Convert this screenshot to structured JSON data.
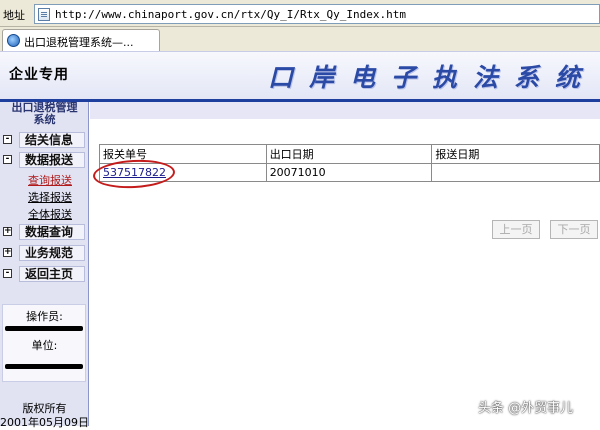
{
  "address_bar": {
    "label": "地址",
    "url": "http://www.chinaport.gov.cn/rtx/Qy_I/Rtx_Qy_Index.htm"
  },
  "tab": {
    "title": "出口退税管理系统—..."
  },
  "banner": {
    "left_label": "企业专用",
    "title": "口岸电子执法系统",
    "title_color": "#2b4aa6"
  },
  "sidebar": {
    "title_line1": "出口退税管理",
    "title_line2": "系统",
    "menus": [
      {
        "toggle": "-",
        "label": "结关信息"
      },
      {
        "toggle": "-",
        "label": "数据报送",
        "children": [
          "查询报送",
          "选择报送",
          "全体报送"
        ]
      },
      {
        "toggle": "+",
        "label": "数据查询"
      },
      {
        "toggle": "+",
        "label": "业务规范"
      },
      {
        "toggle": "-",
        "label": "返回主页"
      }
    ],
    "operator_label": "操作员:",
    "unit_label": "单位:",
    "copyright": "版权所有",
    "date": "2001年05月09日"
  },
  "grid": {
    "headers": [
      "报关单号",
      "出口日期",
      "报送日期"
    ],
    "rows": [
      [
        "537517822",
        "20071010",
        ""
      ]
    ]
  },
  "pager": {
    "prev": "上一页",
    "next": "下一页"
  },
  "watermark": "头条 @外贸事儿",
  "colors": {
    "accent": "#1f3f9e",
    "highlight_circle": "#c41b1b",
    "active_link": "#b01a1a"
  }
}
